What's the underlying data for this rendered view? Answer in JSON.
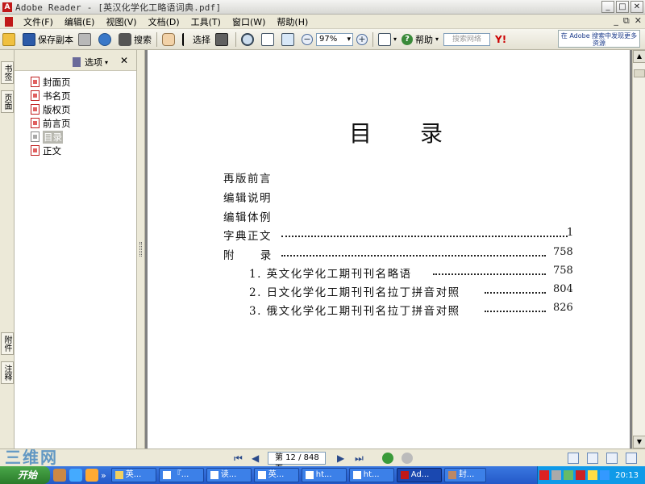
{
  "window": {
    "title": "Adobe Reader - [英汉化学化工略语词典.pdf]",
    "controls": [
      "_",
      "□",
      "✕"
    ]
  },
  "menu": {
    "items": [
      "文件(F)",
      "编辑(E)",
      "视图(V)",
      "文档(D)",
      "工具(T)",
      "窗口(W)",
      "帮助(H)"
    ],
    "doc_controls": [
      "_",
      "⧉",
      "✕"
    ]
  },
  "toolbar": {
    "save_copy": "保存副本",
    "search": "搜索",
    "select": "选择",
    "zoom_value": "97%",
    "help": "帮助",
    "search_web_placeholder": "搜索网络",
    "yahoo": "Y!",
    "adobe_promo": "在 Adobe 搜索中发现更多资源"
  },
  "side_tabs": [
    "书签",
    "页面",
    "附件",
    "注释"
  ],
  "nav_panel": {
    "options_label": "选项",
    "close": "✕",
    "bookmarks": [
      {
        "label": "封面页",
        "selected": false
      },
      {
        "label": "书名页",
        "selected": false
      },
      {
        "label": "版权页",
        "selected": false
      },
      {
        "label": "前言页",
        "selected": false
      },
      {
        "label": "目录",
        "selected": true
      },
      {
        "label": "正文",
        "selected": false
      }
    ]
  },
  "document": {
    "heading": "目录",
    "toc": [
      {
        "text": "再版前言",
        "page": ""
      },
      {
        "text": "编辑说明",
        "page": ""
      },
      {
        "text": "编辑体例",
        "page": ""
      },
      {
        "text": "字典正文",
        "page": "1"
      },
      {
        "text": "附  录",
        "page": "758"
      },
      {
        "text": "1.  英文化学化工期刊刊名略语",
        "page": "758"
      },
      {
        "text": "2.  日文化学化工期刊刊名拉丁拼音对照",
        "page": "804"
      },
      {
        "text": "3.  俄文化学化工期刊刊名拉丁拼音对照",
        "page": "826"
      }
    ]
  },
  "statusbar": {
    "page_indicator": "第 12 / 848 页",
    "watermark": "三维网"
  },
  "taskbar": {
    "start_label": "开始",
    "tasks": [
      "英...",
      "『...",
      "读...",
      "英...",
      "ht...",
      "ht...",
      "Ad...",
      "封..."
    ],
    "clock": "20:13"
  },
  "colors": {
    "titlebar": "#ece9d8",
    "taskbar": "#2458c8",
    "start_button": "#2a7a2a",
    "selected_bookmark": "#b8b8b0",
    "doc_background": "#808080"
  }
}
